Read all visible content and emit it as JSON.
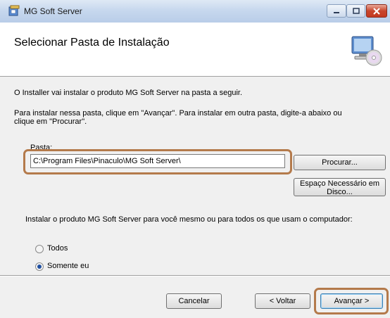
{
  "window": {
    "title": "MG Soft Server"
  },
  "header": {
    "title": "Selecionar Pasta de Instalação"
  },
  "body": {
    "intro": "O Installer vai instalar o produto MG Soft Server na pasta a seguir.",
    "instructions_line1": "Para instalar nessa pasta, clique em \"Avançar\". Para instalar em outra pasta, digite-a abaixo ou",
    "instructions_line2": "clique em \"Procurar\".",
    "folder_label": "Pasta:",
    "folder_value": "C:\\Program Files\\Pinaculo\\MG Soft Server\\",
    "browse_label": "Procurar...",
    "disk_space_line1": "Espaço Necessário em",
    "disk_space_line2": "Disco...",
    "install_for_text": "Instalar o produto MG Soft Server para você mesmo ou para todos os que usam o computador:",
    "radio_options": [
      {
        "label": "Todos",
        "selected": false
      },
      {
        "label": "Somente eu",
        "selected": true
      }
    ]
  },
  "footer": {
    "cancel_label": "Cancelar",
    "back_label": "< Voltar",
    "next_label": "Avançar >"
  },
  "colors": {
    "highlight": "#b47a4b",
    "titlebar": "#c7d8ee",
    "close": "#c8462c"
  },
  "icons": [
    "installer-app-icon",
    "minimize-icon",
    "maximize-icon",
    "close-icon",
    "computer-cd-icon"
  ]
}
